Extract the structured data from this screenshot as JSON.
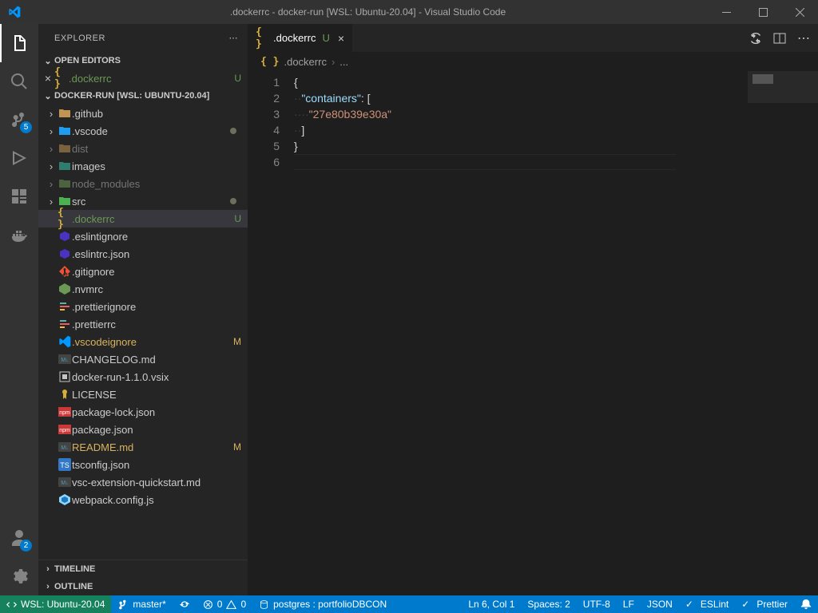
{
  "window": {
    "title": ".dockerrc - docker-run [WSL: Ubuntu-20.04] - Visual Studio Code"
  },
  "activity": {
    "scm_badge": "5",
    "accounts_badge": "2"
  },
  "explorer": {
    "title": "EXPLORER",
    "sections": {
      "open_editors": "OPEN EDITORS",
      "workspace": "DOCKER-RUN [WSL: UBUNTU-20.04]",
      "timeline": "TIMELINE",
      "outline": "OUTLINE"
    },
    "open_editor_file": {
      "name": ".dockerrc",
      "status": "U"
    },
    "tree": [
      {
        "type": "folder",
        "name": ".github",
        "icon": "folder"
      },
      {
        "type": "folder",
        "name": ".vscode",
        "icon": "vscode-folder",
        "dot": true
      },
      {
        "type": "folder",
        "name": "dist",
        "icon": "folder",
        "dim": true
      },
      {
        "type": "folder",
        "name": "images",
        "icon": "images-folder"
      },
      {
        "type": "folder",
        "name": "node_modules",
        "icon": "node-folder",
        "dim": true
      },
      {
        "type": "folder",
        "name": "src",
        "icon": "src-folder",
        "dot": true
      },
      {
        "type": "file",
        "name": ".dockerrc",
        "icon": "braces",
        "git": "U",
        "selected": true
      },
      {
        "type": "file",
        "name": ".eslintignore",
        "icon": "eslint"
      },
      {
        "type": "file",
        "name": ".eslintrc.json",
        "icon": "eslint"
      },
      {
        "type": "file",
        "name": ".gitignore",
        "icon": "git"
      },
      {
        "type": "file",
        "name": ".nvmrc",
        "icon": "node"
      },
      {
        "type": "file",
        "name": ".prettierignore",
        "icon": "prettier"
      },
      {
        "type": "file",
        "name": ".prettierrc",
        "icon": "prettier"
      },
      {
        "type": "file",
        "name": ".vscodeignore",
        "icon": "vscode",
        "git": "M"
      },
      {
        "type": "file",
        "name": "CHANGELOG.md",
        "icon": "md"
      },
      {
        "type": "file",
        "name": "docker-run-1.1.0.vsix",
        "icon": "vsix"
      },
      {
        "type": "file",
        "name": "LICENSE",
        "icon": "license"
      },
      {
        "type": "file",
        "name": "package-lock.json",
        "icon": "npm"
      },
      {
        "type": "file",
        "name": "package.json",
        "icon": "npm"
      },
      {
        "type": "file",
        "name": "README.md",
        "icon": "md",
        "git": "M"
      },
      {
        "type": "file",
        "name": "tsconfig.json",
        "icon": "ts"
      },
      {
        "type": "file",
        "name": "vsc-extension-quickstart.md",
        "icon": "md"
      },
      {
        "type": "file",
        "name": "webpack.config.js",
        "icon": "webpack"
      }
    ]
  },
  "editor": {
    "tab": {
      "name": ".dockerrc",
      "status": "U"
    },
    "breadcrumb": {
      "file": ".dockerrc",
      "more": "..."
    },
    "code": {
      "key": "\"containers\"",
      "value": "\"27e80b39e30a\""
    }
  },
  "status": {
    "remote": "WSL: Ubuntu-20.04",
    "branch": "master*",
    "sync": "",
    "errors": "0",
    "warnings": "0",
    "db": "postgres : portfolioDBCON",
    "pos": "Ln 6, Col 1",
    "spaces": "Spaces: 2",
    "encoding": "UTF-8",
    "eol": "LF",
    "lang": "JSON",
    "eslint": "ESLint",
    "prettier": "Prettier"
  }
}
